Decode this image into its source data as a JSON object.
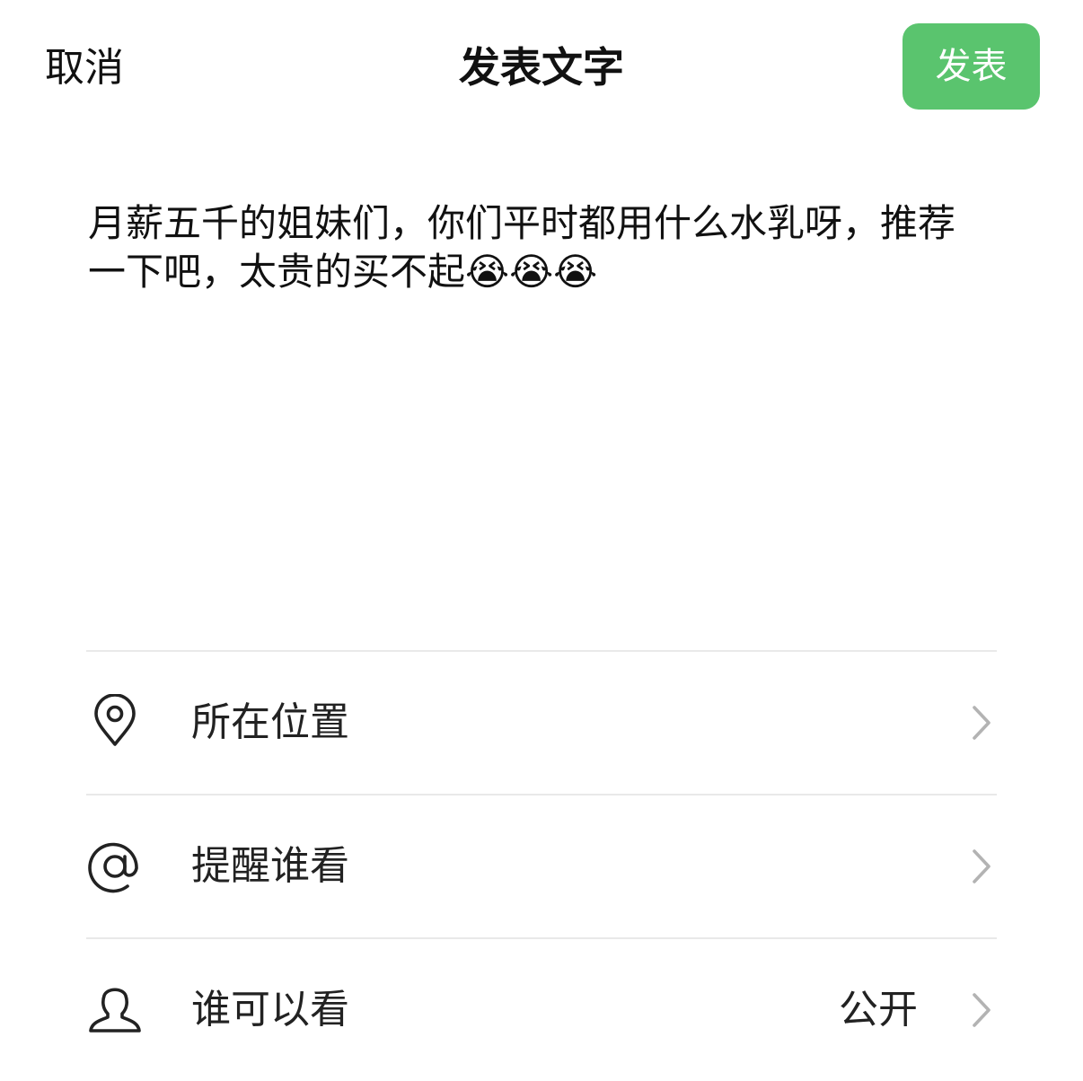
{
  "header": {
    "cancel_label": "取消",
    "title": "发表文字",
    "publish_label": "发表"
  },
  "composer": {
    "text": "月薪五千的姐妹们，你们平时都用什么水乳呀，推荐一下吧，太贵的买不起😭😭😭"
  },
  "options": {
    "location": {
      "label": "所在位置",
      "icon": "location-pin-icon"
    },
    "mention": {
      "label": "提醒谁看",
      "icon": "at-sign-icon"
    },
    "visibility": {
      "label": "谁可以看",
      "value": "公开",
      "icon": "person-icon"
    }
  },
  "colors": {
    "accent": "#5ac46e",
    "divider": "#e9e9e9",
    "chevron": "#b3b3b3"
  }
}
